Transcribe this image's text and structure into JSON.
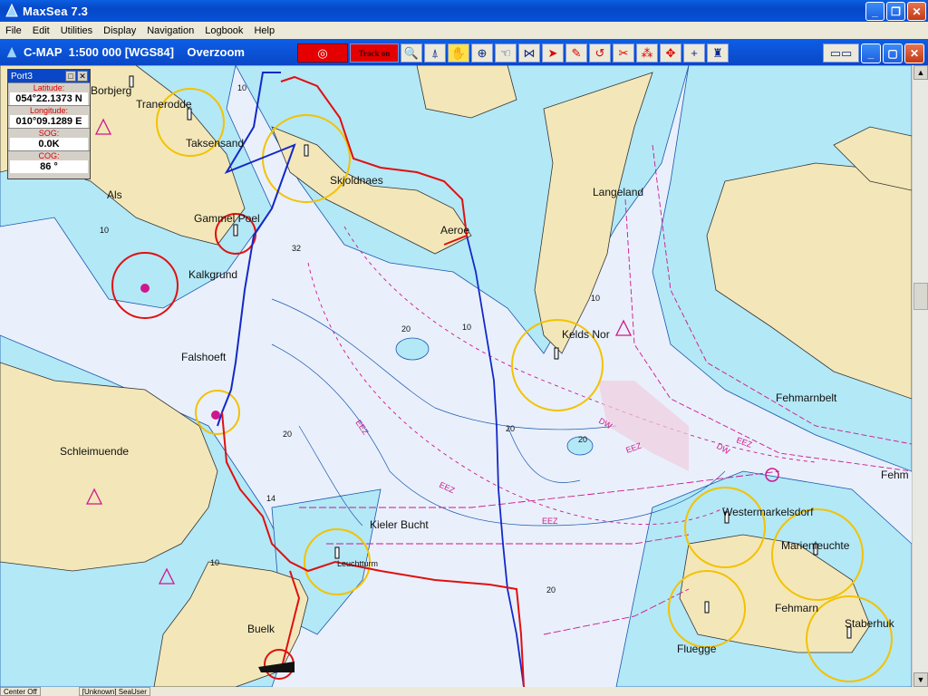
{
  "window": {
    "title": "MaxSea 7.3",
    "buttons": [
      "_",
      "❐",
      "✕"
    ]
  },
  "menu": [
    "File",
    "Edit",
    "Utilities",
    "Display",
    "Navigation",
    "Logbook",
    "Help"
  ],
  "chart_header": {
    "title": "C-MAP  1:500 000 [WGS84]    Overzoom"
  },
  "toolbar": {
    "track_label": "Track on"
  },
  "nav_panel": {
    "title": "Port3",
    "latitude_label": "Latitude:",
    "latitude": "054°22.1373 N",
    "longitude_label": "Longitude:",
    "longitude": "010°09.1289 E",
    "sog_label": "SOG:",
    "sog": "0.0K",
    "cog_label": "COG:",
    "cog": "86 °"
  },
  "places": {
    "bagenkop_partial": "Borbjerg",
    "trane": "Tranerodde",
    "taksensand": "Taksensand",
    "als": "Als",
    "gammel_poel": "Gammel Poel",
    "kalkgrund": "Kalkgrund",
    "falshoeft": "Falshoeft",
    "schleimuende": "Schleimuende",
    "skjoldnaes": "Skjoldnaes",
    "aeroe": "Aeroe",
    "langeland": "Langeland",
    "keldsnor": "Kelds Nor",
    "fehmarnbelt": "Fehmarnbelt",
    "fehm": "Fehm",
    "kieler_bucht": "Kieler Bucht",
    "kiel_light": "Leuchtturm",
    "buelk": "Buelk",
    "westermarkelsdorf": "Westermarkelsdorf",
    "marienleuchte": "Marienleuchte",
    "fehmarn": "Fehmarn",
    "staberhuk": "Staberhuk",
    "fluegge": "Fluegge"
  },
  "depths": {
    "d32": "32",
    "d20a": "20",
    "d20b": "20",
    "d14": "14",
    "d20c": "20",
    "d10a": "10",
    "d10b": "10",
    "d10c": "10",
    "d20d": "20",
    "d20e": "20",
    "d10d": "10",
    "d10e": "10"
  },
  "zones": {
    "eez1": "EEZ",
    "eez2": "EEZ",
    "eez3": "EEZ",
    "eez4": "EEZ",
    "eez5": "EEZ",
    "dw1": "DW",
    "dw2": "DW"
  },
  "status": {
    "center": "Center Off",
    "user": "[Unknown] SeaUser"
  },
  "colors": {
    "land": "#f3e7b9",
    "shallow": "#b3e8f6",
    "deep": "#e9f0fb",
    "track_red": "#e01010",
    "route_blue": "#1428c8",
    "sector_yellow": "#f3c200",
    "eez_magenta": "#d0168c"
  }
}
